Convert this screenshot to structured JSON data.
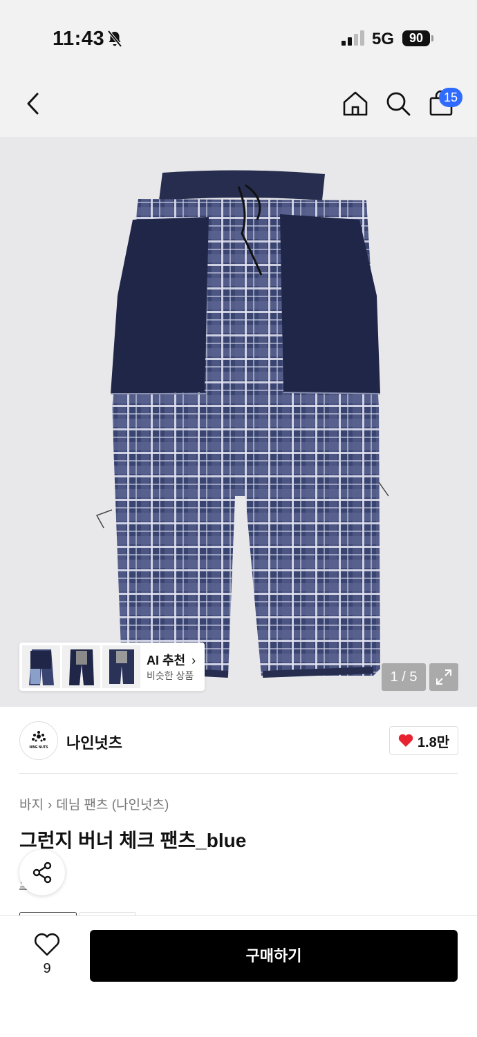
{
  "status": {
    "time": "11:43",
    "network": "5G",
    "battery": "90"
  },
  "nav": {
    "cart_count": "15"
  },
  "gallery": {
    "page_indicator": "1 / 5"
  },
  "ai_recommend": {
    "title": "AI 추천",
    "subtitle": "비슷한 상품"
  },
  "brand": {
    "name": "나인넛츠",
    "logo_text": "NINE NUTS",
    "likes": "1.8만"
  },
  "breadcrumb": {
    "category": "바지",
    "subcategory": "데님 팬츠 (나인넛츠)"
  },
  "product": {
    "title": "그런지 버너 체크 팬츠_blue",
    "partial_link": "소개"
  },
  "bottom": {
    "wish_count": "9",
    "buy_label": "구매하기"
  },
  "colors": {
    "accent_blue": "#2f6bff",
    "heart_red": "#e8232f",
    "buy_button": "#000000"
  }
}
